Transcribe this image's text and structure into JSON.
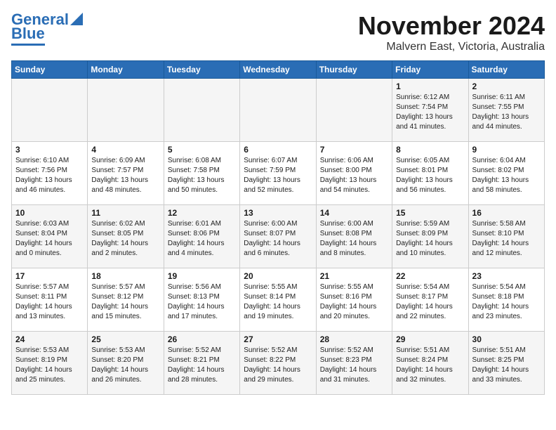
{
  "header": {
    "logo_line1": "General",
    "logo_line2": "Blue",
    "month_title": "November 2024",
    "subtitle": "Malvern East, Victoria, Australia"
  },
  "days_of_week": [
    "Sunday",
    "Monday",
    "Tuesday",
    "Wednesday",
    "Thursday",
    "Friday",
    "Saturday"
  ],
  "weeks": [
    {
      "days": [
        {
          "date": "",
          "info": ""
        },
        {
          "date": "",
          "info": ""
        },
        {
          "date": "",
          "info": ""
        },
        {
          "date": "",
          "info": ""
        },
        {
          "date": "",
          "info": ""
        },
        {
          "date": "1",
          "info": "Sunrise: 6:12 AM\nSunset: 7:54 PM\nDaylight: 13 hours\nand 41 minutes."
        },
        {
          "date": "2",
          "info": "Sunrise: 6:11 AM\nSunset: 7:55 PM\nDaylight: 13 hours\nand 44 minutes."
        }
      ]
    },
    {
      "days": [
        {
          "date": "3",
          "info": "Sunrise: 6:10 AM\nSunset: 7:56 PM\nDaylight: 13 hours\nand 46 minutes."
        },
        {
          "date": "4",
          "info": "Sunrise: 6:09 AM\nSunset: 7:57 PM\nDaylight: 13 hours\nand 48 minutes."
        },
        {
          "date": "5",
          "info": "Sunrise: 6:08 AM\nSunset: 7:58 PM\nDaylight: 13 hours\nand 50 minutes."
        },
        {
          "date": "6",
          "info": "Sunrise: 6:07 AM\nSunset: 7:59 PM\nDaylight: 13 hours\nand 52 minutes."
        },
        {
          "date": "7",
          "info": "Sunrise: 6:06 AM\nSunset: 8:00 PM\nDaylight: 13 hours\nand 54 minutes."
        },
        {
          "date": "8",
          "info": "Sunrise: 6:05 AM\nSunset: 8:01 PM\nDaylight: 13 hours\nand 56 minutes."
        },
        {
          "date": "9",
          "info": "Sunrise: 6:04 AM\nSunset: 8:02 PM\nDaylight: 13 hours\nand 58 minutes."
        }
      ]
    },
    {
      "days": [
        {
          "date": "10",
          "info": "Sunrise: 6:03 AM\nSunset: 8:04 PM\nDaylight: 14 hours\nand 0 minutes."
        },
        {
          "date": "11",
          "info": "Sunrise: 6:02 AM\nSunset: 8:05 PM\nDaylight: 14 hours\nand 2 minutes."
        },
        {
          "date": "12",
          "info": "Sunrise: 6:01 AM\nSunset: 8:06 PM\nDaylight: 14 hours\nand 4 minutes."
        },
        {
          "date": "13",
          "info": "Sunrise: 6:00 AM\nSunset: 8:07 PM\nDaylight: 14 hours\nand 6 minutes."
        },
        {
          "date": "14",
          "info": "Sunrise: 6:00 AM\nSunset: 8:08 PM\nDaylight: 14 hours\nand 8 minutes."
        },
        {
          "date": "15",
          "info": "Sunrise: 5:59 AM\nSunset: 8:09 PM\nDaylight: 14 hours\nand 10 minutes."
        },
        {
          "date": "16",
          "info": "Sunrise: 5:58 AM\nSunset: 8:10 PM\nDaylight: 14 hours\nand 12 minutes."
        }
      ]
    },
    {
      "days": [
        {
          "date": "17",
          "info": "Sunrise: 5:57 AM\nSunset: 8:11 PM\nDaylight: 14 hours\nand 13 minutes."
        },
        {
          "date": "18",
          "info": "Sunrise: 5:57 AM\nSunset: 8:12 PM\nDaylight: 14 hours\nand 15 minutes."
        },
        {
          "date": "19",
          "info": "Sunrise: 5:56 AM\nSunset: 8:13 PM\nDaylight: 14 hours\nand 17 minutes."
        },
        {
          "date": "20",
          "info": "Sunrise: 5:55 AM\nSunset: 8:14 PM\nDaylight: 14 hours\nand 19 minutes."
        },
        {
          "date": "21",
          "info": "Sunrise: 5:55 AM\nSunset: 8:16 PM\nDaylight: 14 hours\nand 20 minutes."
        },
        {
          "date": "22",
          "info": "Sunrise: 5:54 AM\nSunset: 8:17 PM\nDaylight: 14 hours\nand 22 minutes."
        },
        {
          "date": "23",
          "info": "Sunrise: 5:54 AM\nSunset: 8:18 PM\nDaylight: 14 hours\nand 23 minutes."
        }
      ]
    },
    {
      "days": [
        {
          "date": "24",
          "info": "Sunrise: 5:53 AM\nSunset: 8:19 PM\nDaylight: 14 hours\nand 25 minutes."
        },
        {
          "date": "25",
          "info": "Sunrise: 5:53 AM\nSunset: 8:20 PM\nDaylight: 14 hours\nand 26 minutes."
        },
        {
          "date": "26",
          "info": "Sunrise: 5:52 AM\nSunset: 8:21 PM\nDaylight: 14 hours\nand 28 minutes."
        },
        {
          "date": "27",
          "info": "Sunrise: 5:52 AM\nSunset: 8:22 PM\nDaylight: 14 hours\nand 29 minutes."
        },
        {
          "date": "28",
          "info": "Sunrise: 5:52 AM\nSunset: 8:23 PM\nDaylight: 14 hours\nand 31 minutes."
        },
        {
          "date": "29",
          "info": "Sunrise: 5:51 AM\nSunset: 8:24 PM\nDaylight: 14 hours\nand 32 minutes."
        },
        {
          "date": "30",
          "info": "Sunrise: 5:51 AM\nSunset: 8:25 PM\nDaylight: 14 hours\nand 33 minutes."
        }
      ]
    }
  ]
}
